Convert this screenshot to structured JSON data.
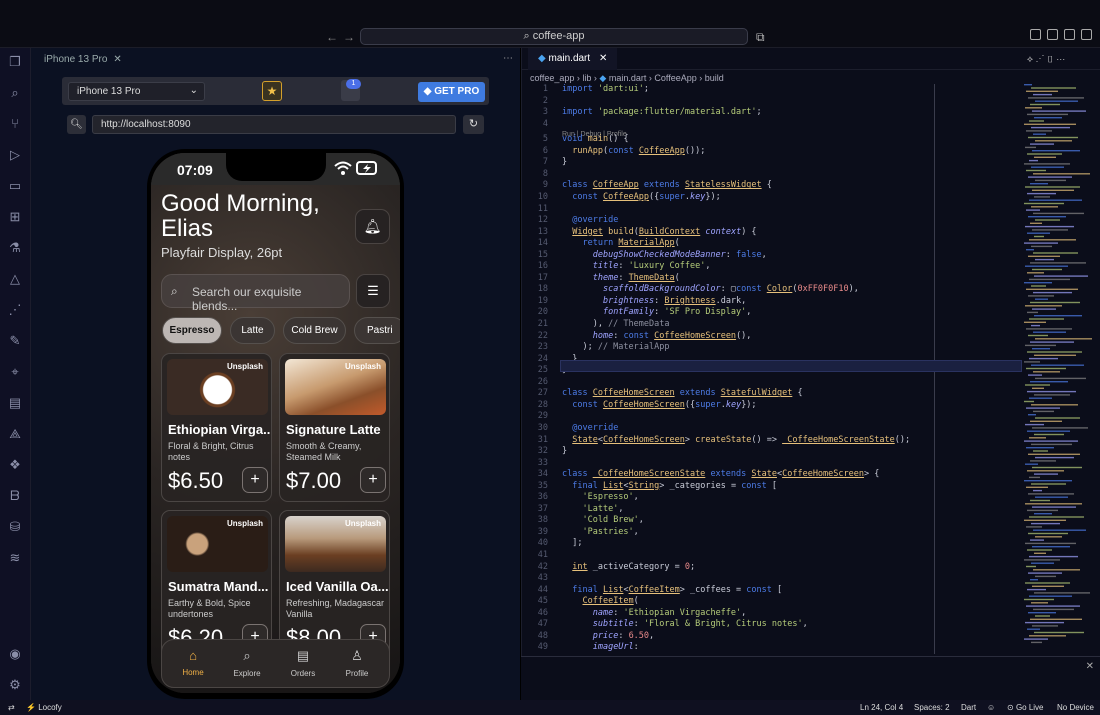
{
  "window": {
    "search_text": "coffee-app"
  },
  "preview_tab": {
    "label": "iPhone 13 Pro"
  },
  "preview_toolbar": {
    "device": "iPhone 13 Pro",
    "badge_count": "1",
    "get_pro": "GET PRO",
    "url": "http://localhost:8090"
  },
  "phone": {
    "time": "07:09",
    "greeting": "Good Morning, Elias",
    "subtitle": "Playfair Display, 26pt",
    "search_placeholder": "Search our exquisite blends...",
    "chips": [
      "Espresso",
      "Latte",
      "Cold Brew",
      "Pastri"
    ],
    "cards": [
      {
        "tag": "Unsplash",
        "name": "Ethiopian Virga...",
        "desc": "Floral & Bright, Citrus notes",
        "price": "$6.50"
      },
      {
        "tag": "Unsplash",
        "name": "Signature Latte",
        "desc": "Smooth & Creamy, Steamed Milk",
        "price": "$7.00"
      },
      {
        "tag": "Unsplash",
        "name": "Sumatra Mand...",
        "desc": "Earthy & Bold, Spice undertones",
        "price": "$6.20"
      },
      {
        "tag": "Unsplash",
        "name": "Iced Vanilla Oa...",
        "desc": "Refreshing, Madagascar Vanilla",
        "price": "$8.00"
      }
    ],
    "nav": [
      "Home",
      "Explore",
      "Orders",
      "Profile"
    ]
  },
  "editor": {
    "tab": "main.dart",
    "breadcrumb": [
      "coffee_app",
      "lib",
      "main.dart",
      "CoffeeApp",
      "build"
    ],
    "codelens": "Run | Debug | Profile"
  },
  "statusbar": {
    "left": "Locofy",
    "position": "Ln 24, Col 4",
    "spaces": "Spaces: 2",
    "language": "Dart",
    "golive": "Go Live",
    "device": "No Device"
  },
  "colors": {
    "accent": "#3f7be0",
    "nav_active": "#f0b046"
  }
}
